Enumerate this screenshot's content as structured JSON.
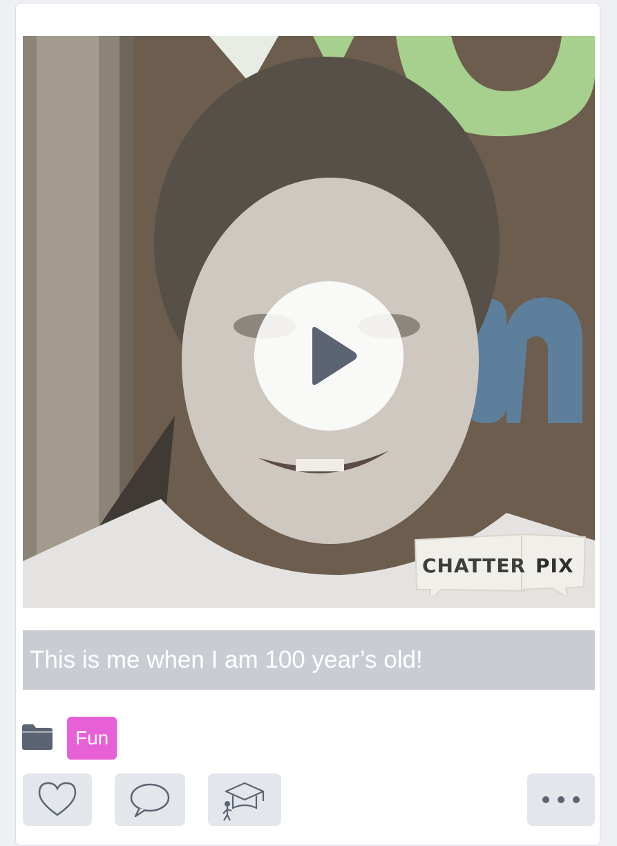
{
  "post": {
    "caption": "This is me when I am 100 year’s old!",
    "tag": "Fun",
    "watermark": {
      "part1": "CHATTER",
      "part2": "PIX"
    }
  },
  "icons": {
    "play": "play-icon",
    "folder": "folder-icon",
    "like": "heart-icon",
    "comment": "speech-bubble-icon",
    "teach": "graduation-cap-icon",
    "more": "more-dots-icon"
  },
  "colors": {
    "tag_bg": "#e860d6",
    "caption_bg": "#c9ccd3",
    "button_bg": "#e3e6ea",
    "icon": "#5c6473"
  }
}
